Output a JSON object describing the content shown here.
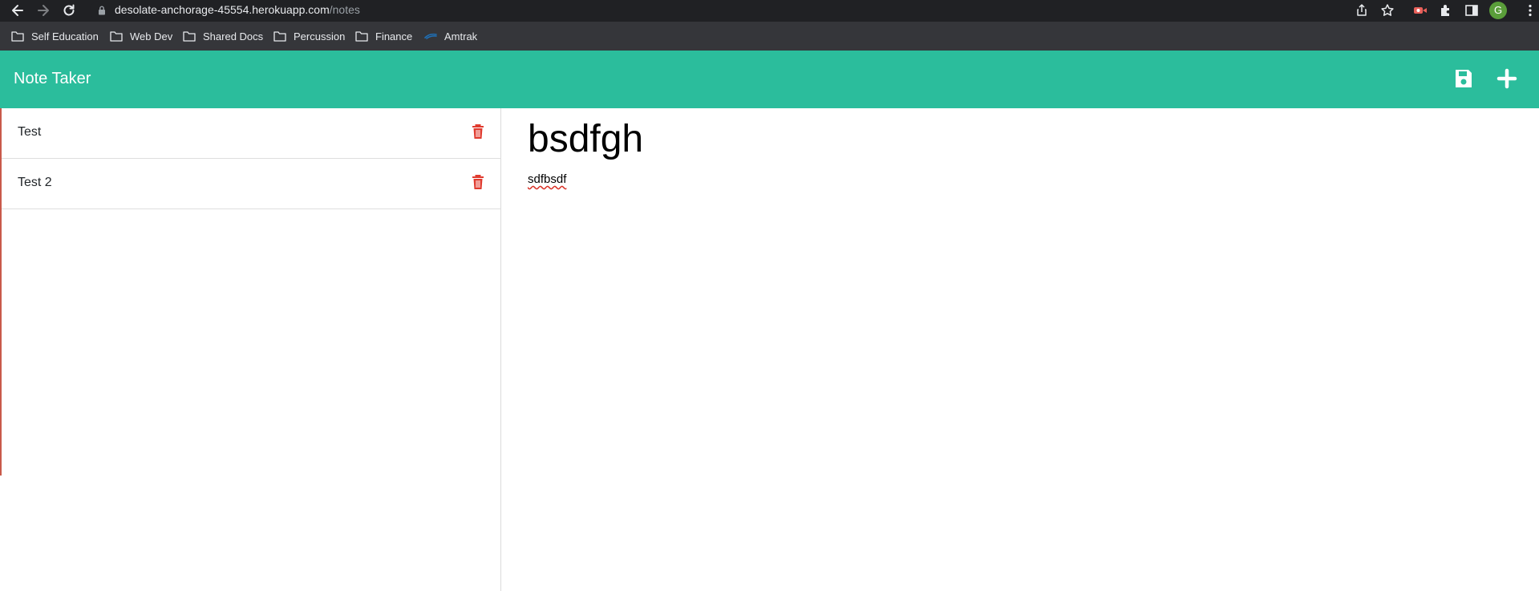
{
  "browser": {
    "url_host": "desolate-anchorage-45554.herokuapp.com",
    "url_path": "/notes",
    "profile_initial": "G",
    "bookmarks": [
      {
        "label": "Self Education",
        "icon": "folder-icon"
      },
      {
        "label": "Web Dev",
        "icon": "folder-icon"
      },
      {
        "label": "Shared Docs",
        "icon": "folder-icon"
      },
      {
        "label": "Percussion",
        "icon": "folder-icon"
      },
      {
        "label": "Finance",
        "icon": "folder-icon"
      },
      {
        "label": "Amtrak",
        "icon": "amtrak-icon"
      }
    ]
  },
  "app": {
    "title": "Note Taker",
    "save_icon": "save-icon",
    "new_icon": "plus-icon",
    "accent_color": "#2bbd9c",
    "delete_color": "#e03b2f"
  },
  "notes": [
    {
      "title": "Test"
    },
    {
      "title": "Test 2"
    }
  ],
  "active_note": {
    "title": "bsdfgh",
    "text": "sdfbsdf"
  }
}
